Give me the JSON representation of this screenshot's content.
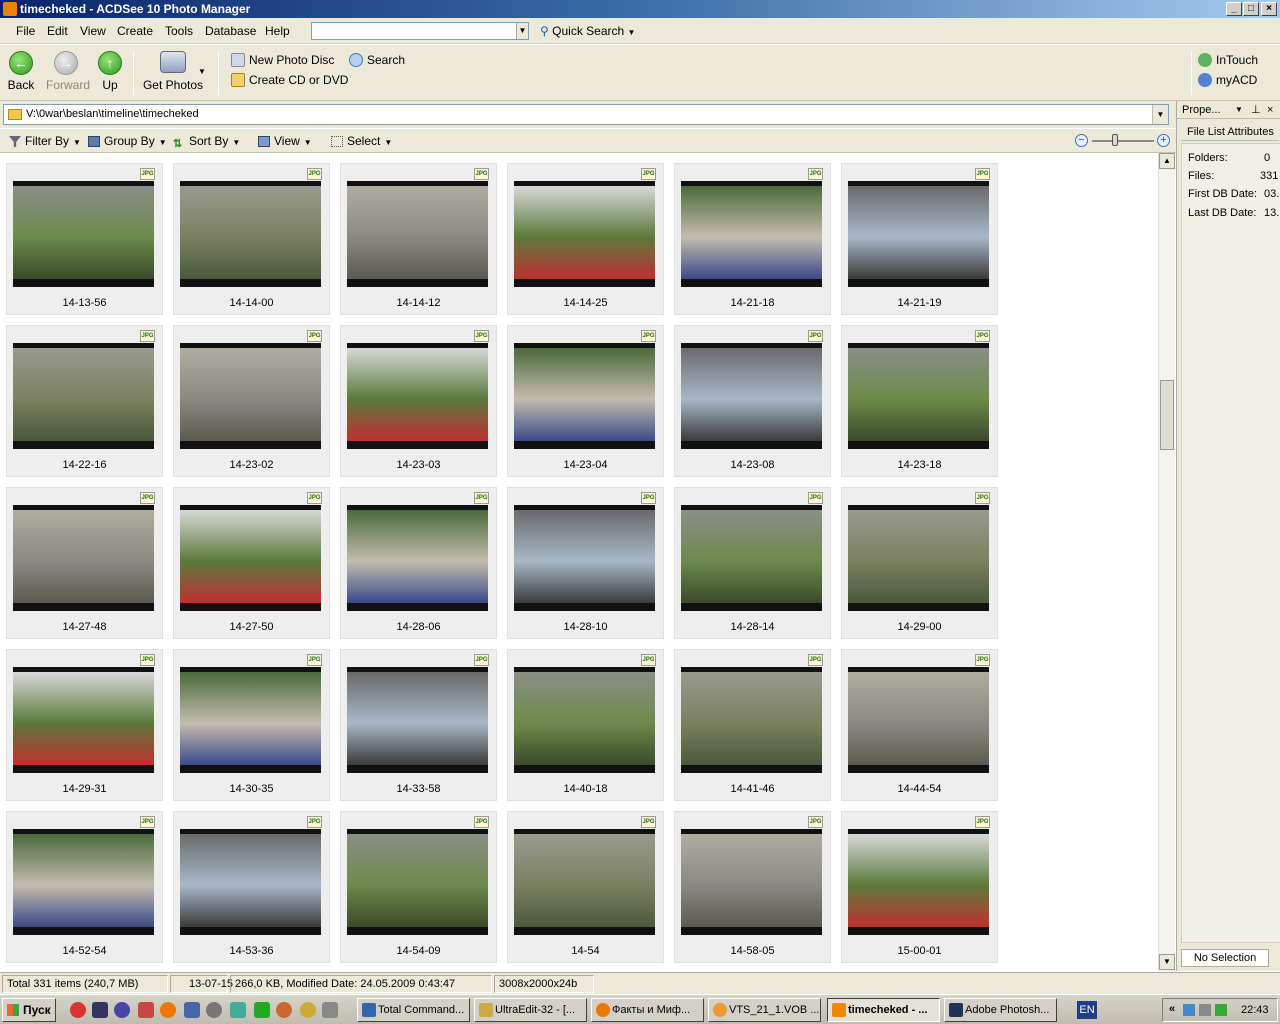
{
  "window": {
    "title": "timecheked - ACDSee 10 Photo Manager",
    "min": "_",
    "max": "□",
    "close": "×"
  },
  "menu": [
    "File",
    "Edit",
    "View",
    "Create",
    "Tools",
    "Database",
    "Help"
  ],
  "quick_search": "Quick Search",
  "toolbar": {
    "back": "Back",
    "forward": "Forward",
    "up": "Up",
    "get_photos": "Get Photos",
    "new_photo_disc": "New Photo Disc",
    "create_cd": "Create CD or DVD",
    "search": "Search",
    "intouch": "InTouch",
    "myacd": "myACD"
  },
  "path": "V:\\0war\\beslan\\timeline\\timecheked",
  "filterbar": {
    "filter": "Filter By",
    "group": "Group By",
    "sort": "Sort By",
    "view": "View",
    "select": "Select"
  },
  "thumb_badge": "JPG",
  "thumbnails": [
    "14-13-56",
    "14-14-00",
    "14-14-12",
    "14-14-25",
    "14-21-18",
    "14-21-19",
    "14-22-16",
    "14-23-02",
    "14-23-03",
    "14-23-04",
    "14-23-08",
    "14-23-18",
    "14-27-48",
    "14-27-50",
    "14-28-06",
    "14-28-10",
    "14-28-14",
    "14-29-00",
    "14-29-31",
    "14-30-35",
    "14-33-58",
    "14-40-18",
    "14-41-46",
    "14-44-54",
    "14-52-54",
    "14-53-36",
    "14-54-09",
    "14-54",
    "14-58-05",
    "15-00-01"
  ],
  "properties": {
    "title": "Prope...",
    "tab": "File List Attributes",
    "rows": [
      {
        "label": "Folders:",
        "value": "0"
      },
      {
        "label": "Files:",
        "value": "331"
      },
      {
        "label": "First DB Date:",
        "value": "03."
      },
      {
        "label": "Last DB Date:",
        "value": "13."
      }
    ],
    "no_selection": "No Selection"
  },
  "status": {
    "total": "Total 331 items  (240,7 MB)",
    "date": "13-07-15",
    "info": "266,0 KB, Modified Date: 24.05.2009 0:43:47",
    "dims": "3008x2000x24b"
  },
  "taskbar": {
    "start": "Пуск",
    "items": [
      "Total Command...",
      "UltraEdit-32 - [...",
      "Факты и Миф...",
      "VTS_21_1.VOB ...",
      "timecheked - ...",
      "Adobe Photosh..."
    ],
    "lang": "EN",
    "clock": "22:43"
  }
}
